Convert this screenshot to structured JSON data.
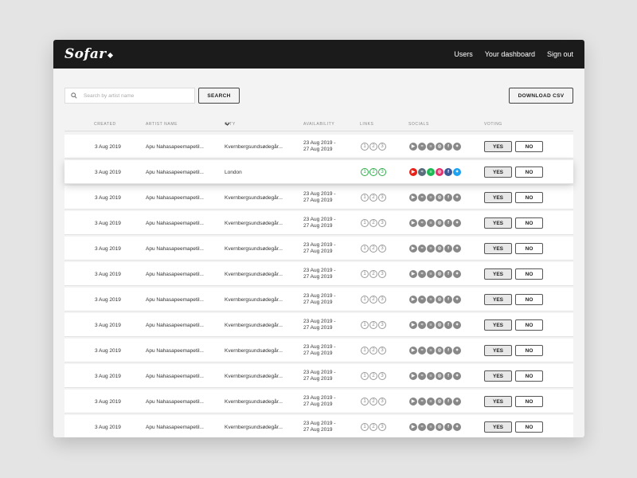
{
  "nav": {
    "logo": "Sofar",
    "users": "Users",
    "dashboard": "Your dashboard",
    "signout": "Sign out"
  },
  "search": {
    "placeholder": "Search by artist name",
    "button": "SEARCH"
  },
  "download_csv": "DOWNLOAD CSV",
  "columns": {
    "created": "CREATED",
    "artist": "ARTIST NAME",
    "city": "CITY",
    "availability": "AVAILABILITY",
    "links": "LINKS",
    "socials": "SOCIALS",
    "voting": "VOTING"
  },
  "vote": {
    "yes": "YES",
    "no": "NO"
  },
  "link_numbers": [
    "1",
    "2",
    "3"
  ],
  "social_icons": [
    "youtube-icon",
    "mixcloud-icon",
    "spotify-icon",
    "instagram-icon",
    "facebook-icon",
    "twitter-icon"
  ],
  "social_colors_active": [
    "#e62117",
    "#5a6d7a",
    "#1db954",
    "#e1306c",
    "#3b5998",
    "#1da1f2"
  ],
  "rows": [
    {
      "created": "3 Aug 2019",
      "artist": "Apu Nahasapeemapetil...",
      "city": "Kvernbergsundsødegår...",
      "avail_1": "23 Aug 2019 -",
      "avail_2": "27 Aug 2019",
      "active": false
    },
    {
      "created": "3 Aug 2019",
      "artist": "Apu Nahasapeemapetil...",
      "city": "London",
      "avail_1": "",
      "avail_2": "",
      "active": true
    },
    {
      "created": "3 Aug 2019",
      "artist": "Apu Nahasapeemapetil...",
      "city": "Kvernbergsundsødegår...",
      "avail_1": "23 Aug 2019 -",
      "avail_2": "27 Aug 2019",
      "active": false
    },
    {
      "created": "3 Aug 2019",
      "artist": "Apu Nahasapeemapetil...",
      "city": "Kvernbergsundsødegår...",
      "avail_1": "23 Aug 2019 -",
      "avail_2": "27 Aug 2019",
      "active": false
    },
    {
      "created": "3 Aug 2019",
      "artist": "Apu Nahasapeemapetil...",
      "city": "Kvernbergsundsødegår...",
      "avail_1": "23 Aug 2019 -",
      "avail_2": "27 Aug 2019",
      "active": false
    },
    {
      "created": "3 Aug 2019",
      "artist": "Apu Nahasapeemapetil...",
      "city": "Kvernbergsundsødegår...",
      "avail_1": "23 Aug 2019 -",
      "avail_2": "27 Aug 2019",
      "active": false
    },
    {
      "created": "3 Aug 2019",
      "artist": "Apu Nahasapeemapetil...",
      "city": "Kvernbergsundsødegår...",
      "avail_1": "23 Aug 2019 -",
      "avail_2": "27 Aug 2019",
      "active": false
    },
    {
      "created": "3 Aug 2019",
      "artist": "Apu Nahasapeemapetil...",
      "city": "Kvernbergsundsødegår...",
      "avail_1": "23 Aug 2019 -",
      "avail_2": "27 Aug 2019",
      "active": false
    },
    {
      "created": "3 Aug 2019",
      "artist": "Apu Nahasapeemapetil...",
      "city": "Kvernbergsundsødegår...",
      "avail_1": "23 Aug 2019 -",
      "avail_2": "27 Aug 2019",
      "active": false
    },
    {
      "created": "3 Aug 2019",
      "artist": "Apu Nahasapeemapetil...",
      "city": "Kvernbergsundsødegår...",
      "avail_1": "23 Aug 2019 -",
      "avail_2": "27 Aug 2019",
      "active": false
    },
    {
      "created": "3 Aug 2019",
      "artist": "Apu Nahasapeemapetil...",
      "city": "Kvernbergsundsødegår...",
      "avail_1": "23 Aug 2019 -",
      "avail_2": "27 Aug 2019",
      "active": false
    },
    {
      "created": "3 Aug 2019",
      "artist": "Apu Nahasapeemapetil...",
      "city": "Kvernbergsundsødegår...",
      "avail_1": "23 Aug 2019 -",
      "avail_2": "27 Aug 2019",
      "active": false
    }
  ]
}
